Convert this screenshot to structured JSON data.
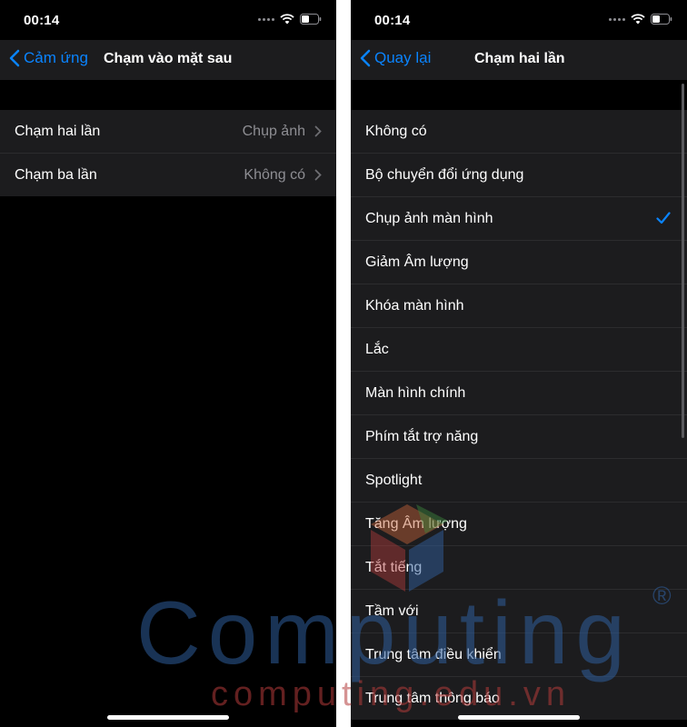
{
  "left_screen": {
    "status_time": "00:14",
    "nav_back_label": "Cảm ứng",
    "nav_title": "Chạm vào mặt sau",
    "rows": [
      {
        "label": "Chạm hai lần",
        "value": "Chụp ảnh"
      },
      {
        "label": "Chạm ba lần",
        "value": "Không có"
      }
    ]
  },
  "right_screen": {
    "status_time": "00:14",
    "nav_back_label": "Quay lại",
    "nav_title": "Chạm hai lần",
    "options": [
      {
        "label": "Không có"
      },
      {
        "label": "Bộ chuyển đổi ứng dụng"
      },
      {
        "label": "Chụp ảnh màn hình",
        "selected": true
      },
      {
        "label": "Giảm Âm lượng"
      },
      {
        "label": "Khóa màn hình"
      },
      {
        "label": "Lắc"
      },
      {
        "label": "Màn hình chính"
      },
      {
        "label": "Phím tắt trợ năng"
      },
      {
        "label": "Spotlight"
      },
      {
        "label": "Tăng Âm lượng"
      },
      {
        "label": "Tắt tiếng"
      },
      {
        "label": "Tầm với"
      },
      {
        "label": "Trung tâm điều khiển"
      },
      {
        "label": "Trung tâm thông báo"
      }
    ]
  },
  "watermark": {
    "brand": "Computing",
    "url": "computing.edu.vn",
    "registered_mark": "®"
  },
  "colors": {
    "accent": "#0a84ff",
    "background": "#000000",
    "cell": "#1c1c1e",
    "secondary_text": "#8e8e93"
  },
  "icons": [
    "signal-dots-icon",
    "wifi-icon",
    "battery-icon",
    "chevron-left-icon",
    "chevron-right-icon",
    "checkmark-icon"
  ]
}
